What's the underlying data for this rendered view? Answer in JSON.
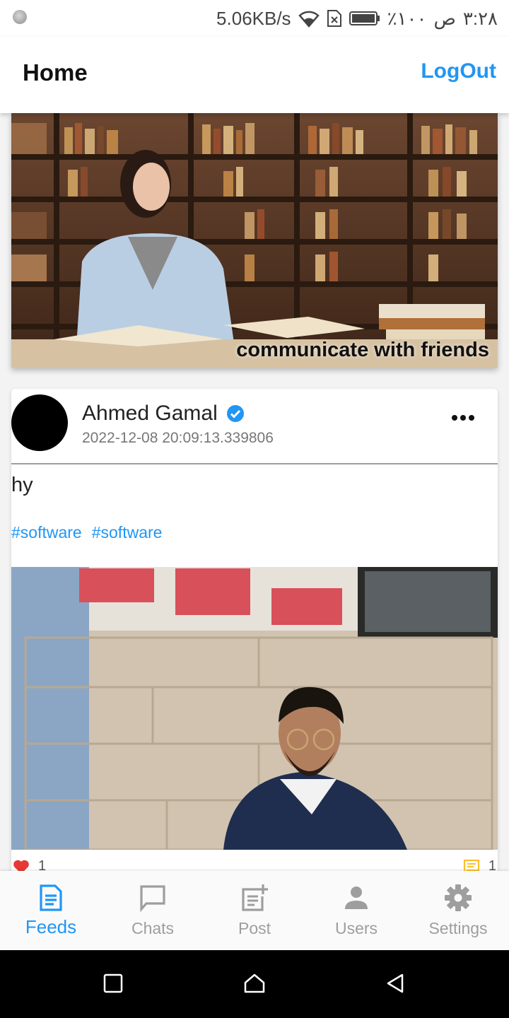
{
  "status_bar": {
    "speed": "5.06KB/s",
    "battery_percent": "٪١٠٠",
    "am_pm": "ص",
    "time": "٣:٢٨"
  },
  "app_bar": {
    "title": "Home",
    "logout_label": "LogOut"
  },
  "banner": {
    "caption": "communicate with friends"
  },
  "post": {
    "author": "Ahmed Gamal",
    "date": "2022-12-08 20:09:13.339806",
    "text": "hy",
    "tags": [
      "#software",
      "#software"
    ],
    "likes": "1",
    "comments": "1"
  },
  "bottom_nav": {
    "items": [
      {
        "label": "Feeds",
        "icon": "feeds-icon",
        "active": true
      },
      {
        "label": "Chats",
        "icon": "chat-icon",
        "active": false
      },
      {
        "label": "Post",
        "icon": "post-add-icon",
        "active": false
      },
      {
        "label": "Users",
        "icon": "person-icon",
        "active": false
      },
      {
        "label": "Settings",
        "icon": "gear-icon",
        "active": false
      }
    ]
  },
  "colors": {
    "accent": "#2196f3",
    "inactive": "#9e9e9e",
    "like": "#e53935",
    "comment": "#fbc02d"
  }
}
